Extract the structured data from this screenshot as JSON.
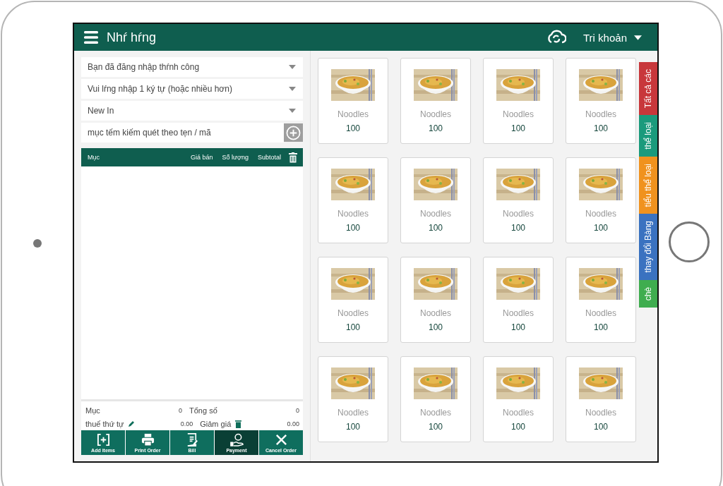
{
  "header": {
    "title": "Nhŕ hŕng",
    "account": "Tri khoản"
  },
  "selects": [
    {
      "value": "Bạn đã đăng nhập thŕnh công"
    },
    {
      "value": "Vui lŕng nhập 1 ký tự (hoặc nhiều hơn)"
    },
    {
      "value": "New In"
    }
  ],
  "search": {
    "placeholder": "mục tếm kiếm quét theo tẹn / mã"
  },
  "order_table": {
    "columns": [
      "Mục",
      "Giá bán",
      "Số lượng",
      "Subtotal"
    ]
  },
  "summary": {
    "items_label": "Mục",
    "items": "0",
    "total_label": "Tổng số",
    "total": "0",
    "tax_label": "thuế thứ tự",
    "tax": "0.00",
    "discount_label": "Giảm giá",
    "discount": "0.00"
  },
  "actions": [
    {
      "label": "Add items",
      "kind": "add",
      "selected": false
    },
    {
      "label": "Print Order",
      "kind": "print",
      "selected": false
    },
    {
      "label": "Bill",
      "kind": "bill",
      "selected": false
    },
    {
      "label": "Payment",
      "kind": "payment",
      "selected": true
    },
    {
      "label": "Cancel Order",
      "kind": "cancel",
      "selected": false
    }
  ],
  "products": [
    {
      "name": "Noodles",
      "price": "100"
    },
    {
      "name": "Noodles",
      "price": "100"
    },
    {
      "name": "Noodles",
      "price": "100"
    },
    {
      "name": "Noodles",
      "price": "100"
    },
    {
      "name": "Noodles",
      "price": "100"
    },
    {
      "name": "Noodles",
      "price": "100"
    },
    {
      "name": "Noodles",
      "price": "100"
    },
    {
      "name": "Noodles",
      "price": "100"
    },
    {
      "name": "Noodles",
      "price": "100"
    },
    {
      "name": "Noodles",
      "price": "100"
    },
    {
      "name": "Noodles",
      "price": "100"
    },
    {
      "name": "Noodles",
      "price": "100"
    },
    {
      "name": "Noodles",
      "price": "100"
    },
    {
      "name": "Noodles",
      "price": "100"
    },
    {
      "name": "Noodles",
      "price": "100"
    },
    {
      "name": "Noodles",
      "price": "100"
    }
  ],
  "category_tabs": [
    {
      "label": "Tất cả các",
      "color": "#c8373b"
    },
    {
      "label": "thể loại",
      "color": "#1a9a7c"
    },
    {
      "label": "tiểu thể loại",
      "color": "#f0921e"
    },
    {
      "label": "thay đổi Bàng",
      "color": "#3a72c0"
    },
    {
      "label": "chè",
      "color": "#3fad4f"
    }
  ]
}
